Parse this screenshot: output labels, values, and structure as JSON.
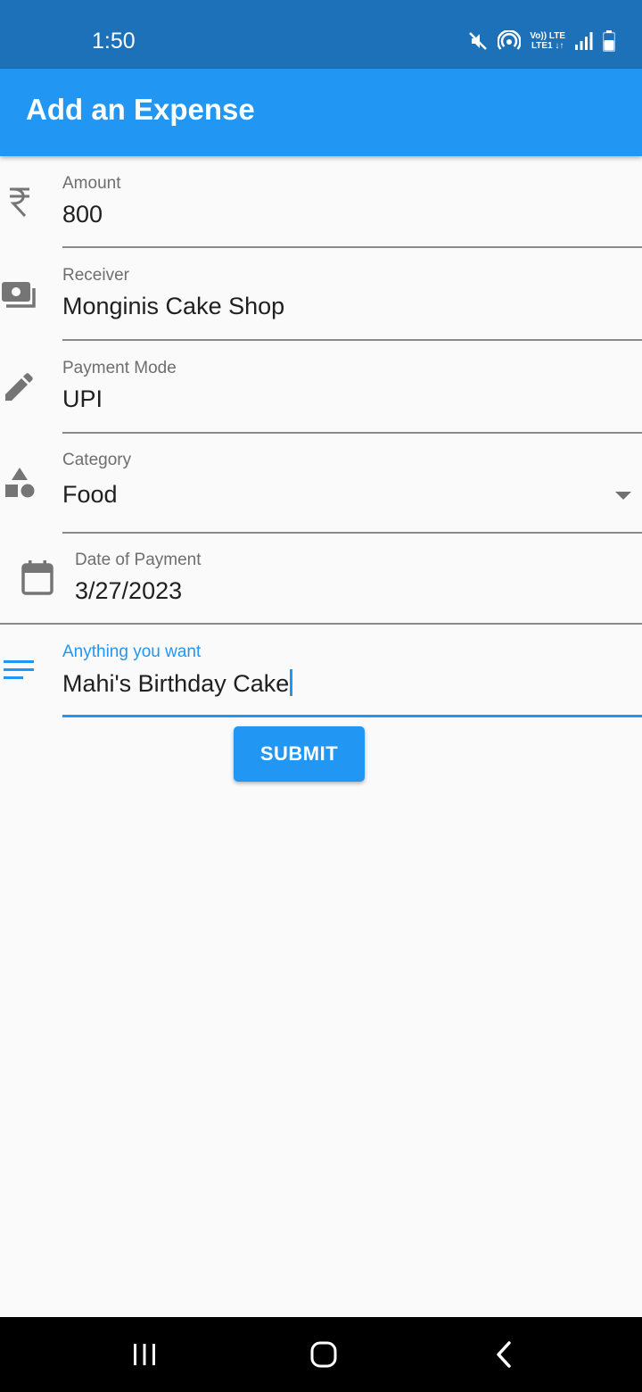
{
  "status_bar": {
    "time": "1:50",
    "lte_top": "Vo)) LTE",
    "lte_bottom": "LTE1 ↓↑",
    "icons": [
      "mute-icon",
      "hotspot-icon",
      "volte-lte-icon",
      "signal-icon",
      "battery-icon"
    ]
  },
  "app_bar": {
    "title": "Add an Expense",
    "color": "#2196f3"
  },
  "form": {
    "amount": {
      "label": "Amount",
      "value": "800",
      "icon": "rupee-icon"
    },
    "receiver": {
      "label": "Receiver",
      "value": "Monginis Cake Shop",
      "icon": "money-icon"
    },
    "payment_mode": {
      "label": "Payment Mode",
      "value": "UPI",
      "icon": "pencil-icon"
    },
    "category": {
      "label": "Category",
      "value": "Food",
      "icon": "category-shapes-icon"
    },
    "date": {
      "label": "Date of Payment",
      "value": "3/27/2023",
      "icon": "calendar-icon"
    },
    "note": {
      "label": "Anything you want",
      "value": "Mahi's Birthday Cake",
      "icon": "notes-icon"
    }
  },
  "submit": {
    "label": "SUBMIT"
  },
  "nav_bar": {
    "icons": [
      "recent-apps-icon",
      "home-icon",
      "back-icon"
    ]
  },
  "colors": {
    "accent": "#2196f3",
    "status_bar": "#1c71b9",
    "icon_gray": "#757575"
  }
}
